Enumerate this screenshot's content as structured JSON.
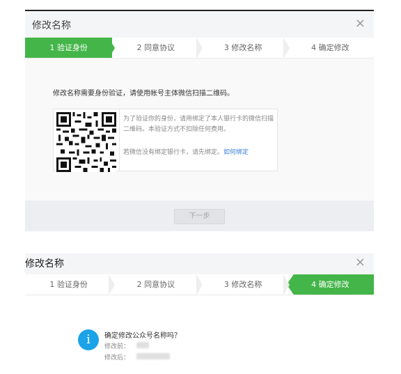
{
  "dialog1": {
    "title": "修改名称",
    "close": "×",
    "steps": [
      {
        "label": "1 验证身份"
      },
      {
        "label": "2 同意协议"
      },
      {
        "label": "3 修改名称"
      },
      {
        "label": "4 确定修改"
      }
    ],
    "intro": "修改名称需要身份验证，请使用帐号主体微信扫描二维码。",
    "qr_text": "为了验证你的身份，请用绑定了本人银行卡的微信扫描二维码。本验证方式不扣除任何费用。",
    "qr_note": "若微信没有绑定银行卡，请先绑定。",
    "qr_link": "如何绑定",
    "next_button": "下一步"
  },
  "dialog2": {
    "title": "修改名称",
    "close": "×",
    "steps": [
      {
        "label": "1 验证身份"
      },
      {
        "label": "2 同意协议"
      },
      {
        "label": "3 修改名称"
      },
      {
        "label": "4 确定修改"
      }
    ],
    "info_icon": "i",
    "question": "确定修改公众号名称吗？",
    "before_label": "修改前：",
    "after_label": "修改后："
  },
  "colors": {
    "accent_green": "#44b549",
    "info_blue": "#1aa3e8",
    "link_blue": "#3b7fd4"
  }
}
